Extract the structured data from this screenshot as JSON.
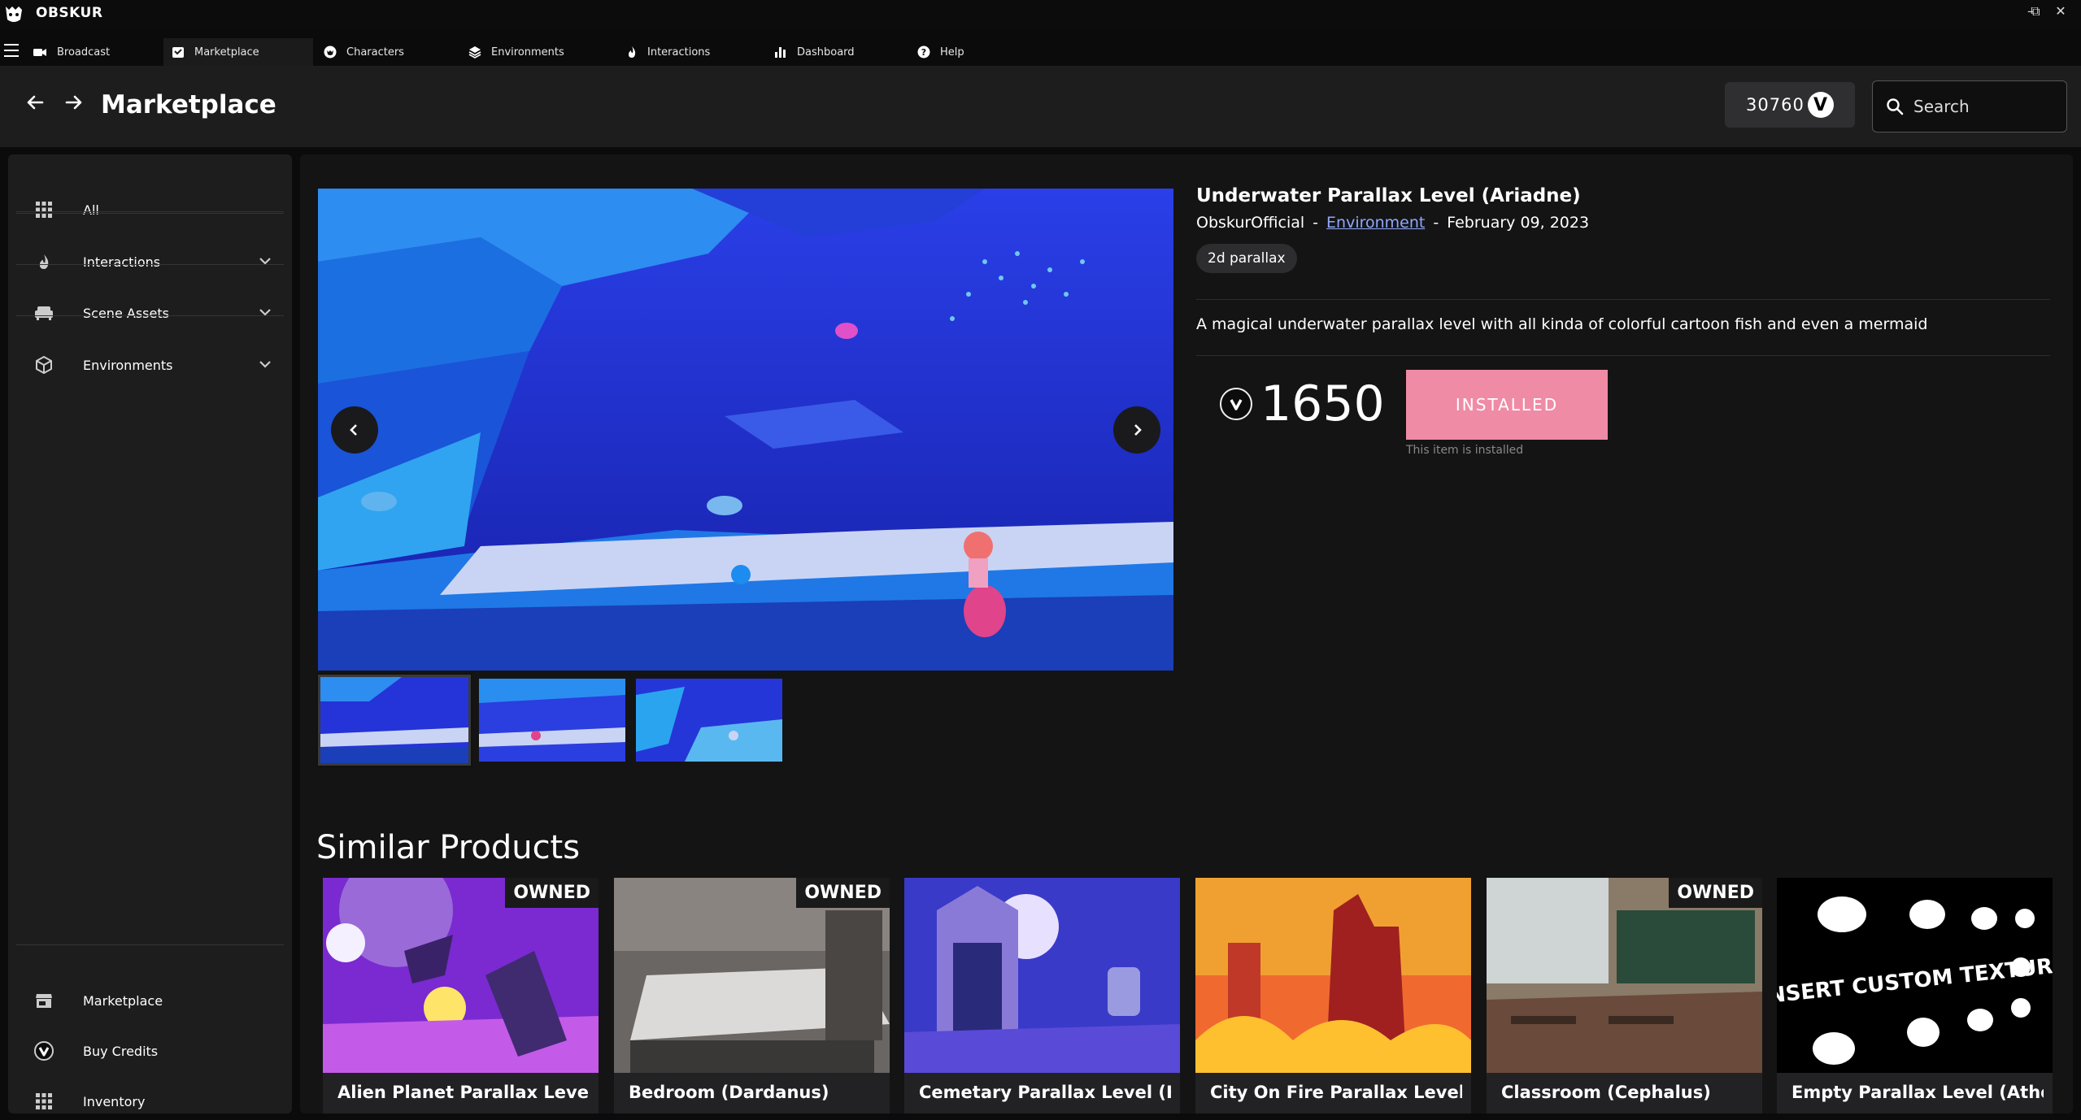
{
  "app": {
    "title": "OBSKUR"
  },
  "tabs": [
    {
      "label": "Broadcast",
      "icon": "video-camera-icon"
    },
    {
      "label": "Marketplace",
      "icon": "store-icon"
    },
    {
      "label": "Characters",
      "icon": "character-icon"
    },
    {
      "label": "Environments",
      "icon": "layers-icon"
    },
    {
      "label": "Interactions",
      "icon": "flame-icon"
    },
    {
      "label": "Dashboard",
      "icon": "bar-chart-icon"
    },
    {
      "label": "Help",
      "icon": "help-icon"
    }
  ],
  "header": {
    "title": "Marketplace",
    "credits": "30760",
    "search_placeholder": "Search"
  },
  "sidebar": {
    "top_items": [
      {
        "label": "All",
        "icon": "grid-icon"
      },
      {
        "label": "Interactions",
        "icon": "flame-icon"
      },
      {
        "label": "Scene Assets",
        "icon": "sofa-icon"
      },
      {
        "label": "Environments",
        "icon": "cube-icon"
      }
    ],
    "bottom_items": [
      {
        "label": "Marketplace",
        "icon": "store-icon"
      },
      {
        "label": "Buy Credits",
        "icon": "coin-icon"
      },
      {
        "label": "Inventory",
        "icon": "grid-icon"
      }
    ]
  },
  "product": {
    "title": "Underwater Parallax Level (Ariadne)",
    "author": "ObskurOfficial",
    "category": "Environment",
    "date": "February 09, 2023",
    "separator": "-",
    "tag": "2d parallax",
    "description": "A magical underwater parallax level with all kinda of colorful cartoon fish and even a mermaid",
    "price": "1650",
    "button_label": "INSTALLED",
    "install_note": "This item is installed"
  },
  "similar": {
    "heading": "Similar Products",
    "owned_label": "OWNED",
    "items": [
      {
        "name": "Alien Planet Parallax Level (…",
        "owned": true
      },
      {
        "name": "Bedroom (Dardanus)",
        "owned": true
      },
      {
        "name": "Cemetary Parallax Level (He…",
        "owned": false
      },
      {
        "name": "City On Fire Parallax Level (P…",
        "owned": false
      },
      {
        "name": "Classroom (Cephalus)",
        "owned": true
      },
      {
        "name": "Empty Parallax Level (Athen…",
        "owned": false
      }
    ],
    "empty_texture_text": "<INSERT CUSTOM TEXTURE>"
  }
}
